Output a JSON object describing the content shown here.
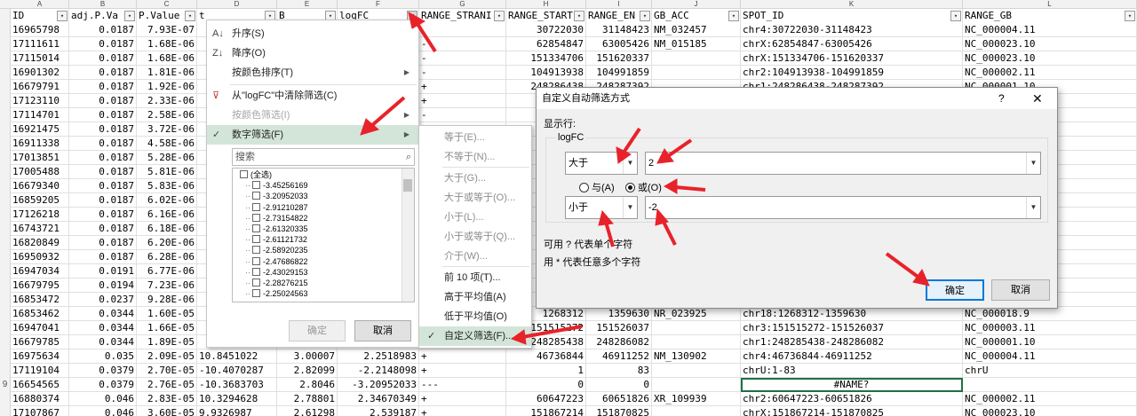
{
  "column_letters": [
    "A",
    "B",
    "C",
    "D",
    "E",
    "F",
    "G",
    "H",
    "I",
    "J",
    "K",
    "L"
  ],
  "headers": [
    "ID",
    "adj.P.Va",
    "P.Value",
    "t",
    "B",
    "logFC",
    "RANGE_STRANI",
    "RANGE_START",
    "RANGE_EN",
    "GB_ACC",
    "SPOT_ID",
    "RANGE_GB"
  ],
  "rows": [
    {
      "rn": "",
      "c": [
        "16965798",
        "0.0187",
        "7.93E-07",
        "",
        "",
        "",
        "",
        "30722030",
        "31148423",
        "NM_032457",
        "chr4:30722030-31148423",
        "NC_000004.11"
      ]
    },
    {
      "rn": "",
      "c": [
        "17111611",
        "0.0187",
        "1.68E-06",
        "",
        "",
        "",
        "-",
        "62854847",
        "63005426",
        "NM_015185",
        "chrX:62854847-63005426",
        "NC_000023.10"
      ]
    },
    {
      "rn": "",
      "c": [
        "17115014",
        "0.0187",
        "1.68E-06",
        "",
        "",
        "",
        "-",
        "151334706",
        "151620337",
        "",
        "chrX:151334706-151620337",
        "NC_000023.10"
      ]
    },
    {
      "rn": "",
      "c": [
        "16901302",
        "0.0187",
        "1.81E-06",
        "",
        "",
        "",
        "-",
        "104913938",
        "104991859",
        "",
        "chr2:104913938-104991859",
        "NC_000002.11"
      ]
    },
    {
      "rn": "",
      "c": [
        "16679791",
        "0.0187",
        "1.92E-06",
        "",
        "",
        "",
        "+",
        "248286438",
        "248287392",
        "",
        "chr1:248286438-248287392",
        "NC_000001.10"
      ]
    },
    {
      "rn": "",
      "c": [
        "17123110",
        "0.0187",
        "2.33E-06",
        "",
        "",
        "",
        "+",
        "",
        "",
        "",
        "",
        ""
      ]
    },
    {
      "rn": "",
      "c": [
        "17114701",
        "0.0187",
        "2.58E-06",
        "",
        "",
        "",
        "-",
        "",
        "",
        "",
        "",
        ""
      ]
    },
    {
      "rn": "",
      "c": [
        "16921475",
        "0.0187",
        "3.72E-06",
        "",
        "",
        "",
        "",
        "",
        "",
        "",
        "",
        ""
      ]
    },
    {
      "rn": "",
      "c": [
        "16911338",
        "0.0187",
        "4.58E-06",
        "",
        "",
        "",
        "",
        "",
        "",
        "",
        "",
        ""
      ]
    },
    {
      "rn": "",
      "c": [
        "17013851",
        "0.0187",
        "5.28E-06",
        "",
        "",
        "",
        "",
        "",
        "",
        "",
        "",
        ""
      ]
    },
    {
      "rn": "",
      "c": [
        "17005488",
        "0.0187",
        "5.81E-06",
        "",
        "",
        "",
        "",
        "",
        "",
        "",
        "",
        ""
      ]
    },
    {
      "rn": "",
      "c": [
        "16679340",
        "0.0187",
        "5.83E-06",
        "",
        "",
        "",
        "",
        "",
        "",
        "",
        "",
        ""
      ]
    },
    {
      "rn": "",
      "c": [
        "16859205",
        "0.0187",
        "6.02E-06",
        "",
        "",
        "",
        "",
        "",
        "",
        "",
        "",
        ""
      ]
    },
    {
      "rn": "",
      "c": [
        "17126218",
        "0.0187",
        "6.16E-06",
        "",
        "",
        "",
        "",
        "",
        "",
        "",
        "",
        ""
      ]
    },
    {
      "rn": "",
      "c": [
        "16743721",
        "0.0187",
        "6.18E-06",
        "",
        "",
        "",
        "",
        "",
        "",
        "",
        "",
        ""
      ]
    },
    {
      "rn": "",
      "c": [
        "16820849",
        "0.0187",
        "6.20E-06",
        "",
        "",
        "",
        "",
        "",
        "",
        "",
        "",
        ""
      ]
    },
    {
      "rn": "",
      "c": [
        "16950932",
        "0.0187",
        "6.28E-06",
        "",
        "",
        "",
        "",
        "",
        "",
        "",
        "",
        ""
      ]
    },
    {
      "rn": "",
      "c": [
        "16947034",
        "0.0191",
        "6.77E-06",
        "",
        "",
        "",
        "",
        "",
        "",
        "",
        "",
        ""
      ]
    },
    {
      "rn": "",
      "c": [
        "16679795",
        "0.0194",
        "7.23E-06",
        "",
        "",
        "",
        "",
        "",
        "",
        "",
        "",
        ""
      ]
    },
    {
      "rn": "",
      "c": [
        "16853472",
        "0.0237",
        "9.28E-06",
        "",
        "",
        "",
        "",
        "",
        "",
        "",
        "",
        ""
      ]
    },
    {
      "rn": "",
      "c": [
        "16853462",
        "0.0344",
        "1.60E-05",
        "",
        "",
        "",
        "",
        "1268312",
        "1359630",
        "NR_023925",
        "chr18:1268312-1359630",
        "NC_000018.9"
      ]
    },
    {
      "rn": "",
      "c": [
        "16947041",
        "0.0344",
        "1.66E-05",
        "",
        "",
        "",
        "",
        "151515272",
        "151526037",
        "",
        "chr3:151515272-151526037",
        "NC_000003.11"
      ]
    },
    {
      "rn": "",
      "c": [
        "16679785",
        "0.0344",
        "1.89E-05",
        "",
        "",
        "",
        "",
        "248285438",
        "248286082",
        "",
        "chr1:248285438-248286082",
        "NC_000001.10"
      ]
    },
    {
      "rn": "",
      "c": [
        "16975634",
        "0.035",
        "2.09E-05",
        "10.8451022",
        "3.00007",
        "2.2518983",
        "+",
        "46736844",
        "46911252",
        "NM_130902",
        "chr4:46736844-46911252",
        "NC_000004.11"
      ]
    },
    {
      "rn": "",
      "c": [
        "17119104",
        "0.0379",
        "2.70E-05",
        "-10.4070287",
        "2.82099",
        "-2.2148098",
        "+",
        "1",
        "83",
        "",
        "chrU:1-83",
        "chrU"
      ]
    },
    {
      "rn": "9",
      "c": [
        "16654565",
        "0.0379",
        "2.76E-05",
        "-10.3683703",
        "2.8046",
        "-3.20952033",
        "---",
        "0",
        "0",
        "",
        "#NAME?",
        ""
      ]
    },
    {
      "rn": "",
      "c": [
        "16880374",
        "0.046",
        "2.83E-05",
        "10.3294628",
        "2.78801",
        "2.34670349",
        "+",
        "60647223",
        "60651826",
        "XR_109939",
        "chr2:60647223-60651826",
        "NC_000002.11"
      ]
    },
    {
      "rn": "",
      "c": [
        "17107867",
        "0.046",
        "3.60E-05",
        "9.9326987",
        "2.61298",
        "2.539187",
        "+",
        "151867214",
        "151870825",
        "",
        "chrX:151867214-151870825",
        "NC_000023.10"
      ]
    }
  ],
  "filter_menu": {
    "sort_asc": "升序(S)",
    "sort_desc": "降序(O)",
    "sort_by_color": "按颜色排序(T)",
    "clear_filter": "从\"logFC\"中清除筛选(C)",
    "filter_by_color": "按颜色筛选(I)",
    "number_filter": "数字筛选(F)",
    "search_placeholder": "搜索",
    "values": [
      "(全选)",
      "-3.45256169",
      "-3.20952033",
      "-2.91210287",
      "-2.73154822",
      "-2.61320335",
      "-2.61121732",
      "-2.58920235",
      "-2.47686822",
      "-2.43029153",
      "-2.28276215",
      "-2.25024563"
    ],
    "ok": "确定",
    "cancel": "取消"
  },
  "number_submenu": [
    "等于(E)...",
    "不等于(N)...",
    "大于(G)...",
    "大于或等于(O)...",
    "小于(L)...",
    "小于或等于(Q)...",
    "介于(W)...",
    "前 10 项(T)...",
    "高于平均值(A)",
    "低于平均值(O)",
    "自定义筛选(F)..."
  ],
  "dialog": {
    "title": "自定义自动筛选方式",
    "help": "?",
    "close": "✕",
    "show_rows": "显示行:",
    "field": "logFC",
    "op1": "大于",
    "val1": "2",
    "and_label": "与(A)",
    "or_label": "或(O)",
    "op2": "小于",
    "val2": "-2",
    "hint1": "可用 ? 代表单个字符",
    "hint2": "用 * 代表任意多个字符",
    "ok": "确定",
    "cancel": "取消"
  },
  "colors": {
    "arrow": "#e8222a",
    "accent_green": "#1e7145",
    "highlight": "#d3e5d8",
    "dialog_ok_border": "#0078d7"
  }
}
